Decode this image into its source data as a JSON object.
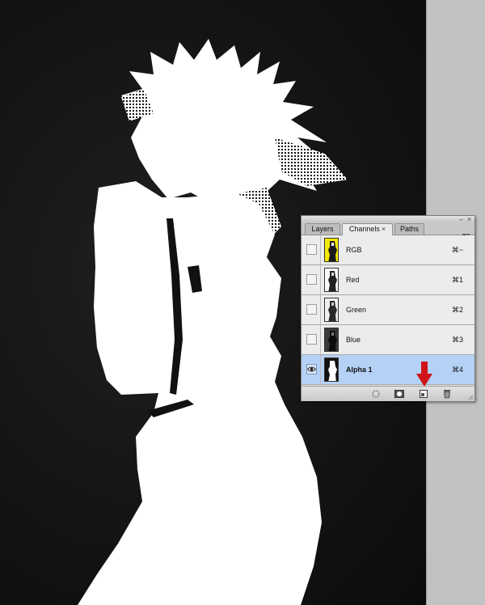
{
  "panel": {
    "tabs": [
      {
        "label": "Layers"
      },
      {
        "label": "Channels"
      },
      {
        "label": "Paths"
      }
    ],
    "close_glyph": "×",
    "window_minimize_glyph": "–",
    "window_close_glyph": "×",
    "menu_glyph": "▾≡"
  },
  "channels": [
    {
      "name": "RGB",
      "shortcut": "⌘~",
      "visible": false,
      "selected": false,
      "thumb": "rgb"
    },
    {
      "name": "Red",
      "shortcut": "⌘1",
      "visible": false,
      "selected": false,
      "thumb": "red"
    },
    {
      "name": "Green",
      "shortcut": "⌘2",
      "visible": false,
      "selected": false,
      "thumb": "green"
    },
    {
      "name": "Blue",
      "shortcut": "⌘3",
      "visible": false,
      "selected": false,
      "thumb": "blue"
    },
    {
      "name": "Alpha 1",
      "shortcut": "⌘4",
      "visible": true,
      "selected": true,
      "thumb": "alpha"
    }
  ],
  "footer": {
    "buttons": [
      {
        "icon": "load-selection-icon"
      },
      {
        "icon": "save-selection-icon"
      },
      {
        "icon": "new-channel-icon"
      },
      {
        "icon": "trash-icon"
      }
    ]
  },
  "colors": {
    "selected_row": "#b5d1f5",
    "arrow": "#d0141a",
    "rgb_thumb": "#f4ea00"
  },
  "annotation": {
    "icon": "arrow-down-icon"
  }
}
